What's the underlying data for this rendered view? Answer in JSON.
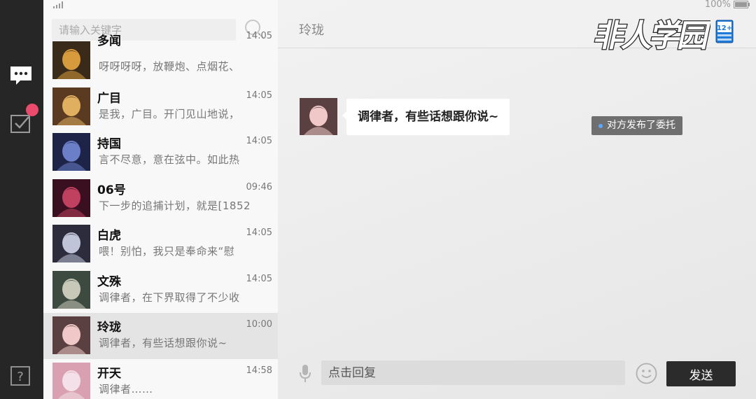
{
  "search": {
    "placeholder": "请输入关键字"
  },
  "status": {
    "battery": "100%"
  },
  "rail": {
    "icons": [
      "chat-bubble-icon",
      "task-check-icon",
      "help-icon"
    ],
    "badge_color": "#ea4b6c"
  },
  "conversations": [
    {
      "name": "多闻",
      "time": "14:05",
      "preview": "呀呀呀呀，放鞭炮、点烟花、",
      "avatar_colors": [
        "#3a2a1a",
        "#d79a3c"
      ]
    },
    {
      "name": "广目",
      "time": "14:05",
      "preview": "是我，广目。开门见山地说，",
      "avatar_colors": [
        "#5a3a20",
        "#e0b060"
      ]
    },
    {
      "name": "持国",
      "time": "14:05",
      "preview": "言不尽意，意在弦中。如此热",
      "avatar_colors": [
        "#1e2448",
        "#6a7fc8"
      ]
    },
    {
      "name": "06号",
      "time": "09:46",
      "preview": "下一步的追捕计划，就是[1852",
      "avatar_colors": [
        "#3a1020",
        "#c04060"
      ]
    },
    {
      "name": "白虎",
      "time": "14:05",
      "preview": "喂！别怕，我只是奉命来“慰",
      "avatar_colors": [
        "#2c2c3c",
        "#c0c4d8"
      ]
    },
    {
      "name": "文殊",
      "time": "14:05",
      "preview": "调律者，在下界取得了不少收",
      "avatar_colors": [
        "#3c4a40",
        "#c8c8b8"
      ]
    },
    {
      "name": "玲珑",
      "time": "10:00",
      "preview": "调律者，有些话想跟你说~",
      "avatar_colors": [
        "#5a4040",
        "#f0c8c8"
      ],
      "selected": true
    },
    {
      "name": "开天",
      "time": "14:58",
      "preview": "调律者……",
      "avatar_colors": [
        "#d8a0b0",
        "#f4e0e8"
      ]
    }
  ],
  "chat": {
    "title": "玲珑",
    "logo_text": "非人学园",
    "age_rating": "12+",
    "messages": [
      {
        "sender": "玲珑",
        "text": "调律者，有些话想跟你说~"
      }
    ],
    "notice": "对方发布了委托",
    "reply_placeholder": "点击回复",
    "send_label": "发送"
  }
}
